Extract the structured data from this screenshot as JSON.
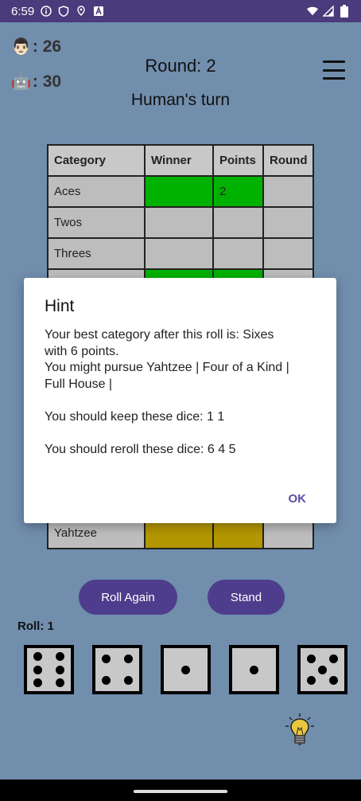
{
  "status_bar": {
    "time": "6:59",
    "left_icons": [
      "info-icon",
      "shield-icon",
      "location-icon",
      "a-icon"
    ],
    "right_icons": [
      "wifi-icon",
      "signal-icon",
      "battery-icon"
    ]
  },
  "scores": {
    "human": {
      "emoji": "👨🏻",
      "value": ": 26"
    },
    "robot": {
      "emoji": "🤖",
      "value": ": 30"
    }
  },
  "header": {
    "round": "Round: 2",
    "turn": "Human's turn"
  },
  "table": {
    "headers": [
      "Category",
      "Winner",
      "Points",
      "Round"
    ],
    "rows": [
      {
        "category": "Aces",
        "points": "2"
      },
      {
        "category": "Twos",
        "points": ""
      },
      {
        "category": "Threes",
        "points": ""
      },
      {
        "category": "Yahtzee",
        "points": ""
      }
    ]
  },
  "dialog": {
    "title": "Hint",
    "line1": "Your best category after this roll is: Sixes",
    "line2": "with 6 points.",
    "line3": "You might pursue Yahtzee | Four of a Kind |",
    "line4": "Full House |",
    "line5": "You should keep these dice: 1 1",
    "line6": "You should reroll these dice: 6 4 5",
    "ok_label": "OK"
  },
  "buttons": {
    "roll_again": "Roll Again",
    "stand": "Stand"
  },
  "roll": {
    "label": "Roll: 1",
    "dice": [
      6,
      4,
      1,
      1,
      5
    ]
  },
  "colors": {
    "background": "#718ead",
    "status_bar": "#4a3b7c",
    "button": "#4e3d8c",
    "winner_green": "#00b200",
    "yahtzee_gold": "#b49600",
    "ok_text": "#5d4aa8"
  }
}
